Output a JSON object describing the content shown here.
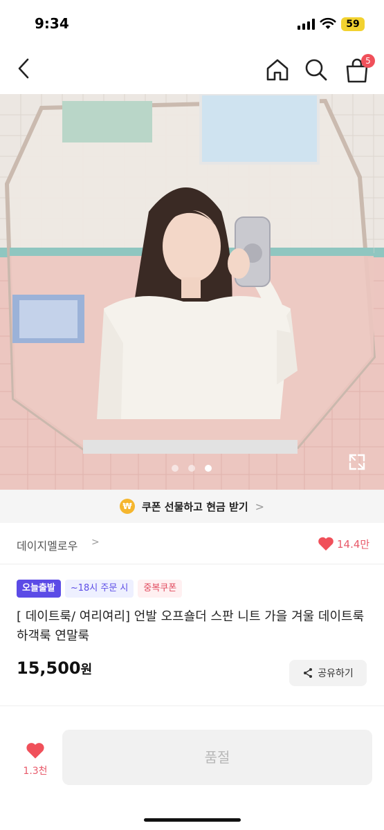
{
  "status_bar": {
    "time": "9:34",
    "battery": "59"
  },
  "nav": {
    "cart_count": "5"
  },
  "icons": {
    "back": "chevron-left-icon",
    "home": "home-icon",
    "search": "search-icon",
    "cart": "shopping-bag-icon",
    "expand": "expand-icon",
    "heart": "heart-icon",
    "share": "share-icon",
    "coin": "won-coin-icon"
  },
  "product_image": {
    "dots_count": 3,
    "active_dot_index": 2
  },
  "coupon_strip": {
    "coin_symbol": "₩",
    "text": "쿠폰 선물하고 현금 받기",
    "chevron": ">"
  },
  "store": {
    "name": "데이지멜로우",
    "chevron": ">",
    "likes": "14.4만"
  },
  "badges": {
    "today_shipping": "오늘출발",
    "order_by": "~18시 주문 시",
    "duplicate_coupon": "중복쿠폰"
  },
  "product": {
    "title": "[ 데이트룩/ 여리여리] 언발 오프숄더 스판 니트 가을 겨울 데이트룩 하객룩 연말룩",
    "price": "15,500",
    "price_unit": "원"
  },
  "share": {
    "label": "공유하기"
  },
  "bottom_bar": {
    "like_count": "1.3천",
    "soldout_label": "품절"
  },
  "colors": {
    "accent_purple": "#5b4be6",
    "heart_red": "#f0505a",
    "likes_text": "#e85a6a",
    "coin_yellow": "#f5b62e",
    "battery_yellow": "#f2d230"
  }
}
